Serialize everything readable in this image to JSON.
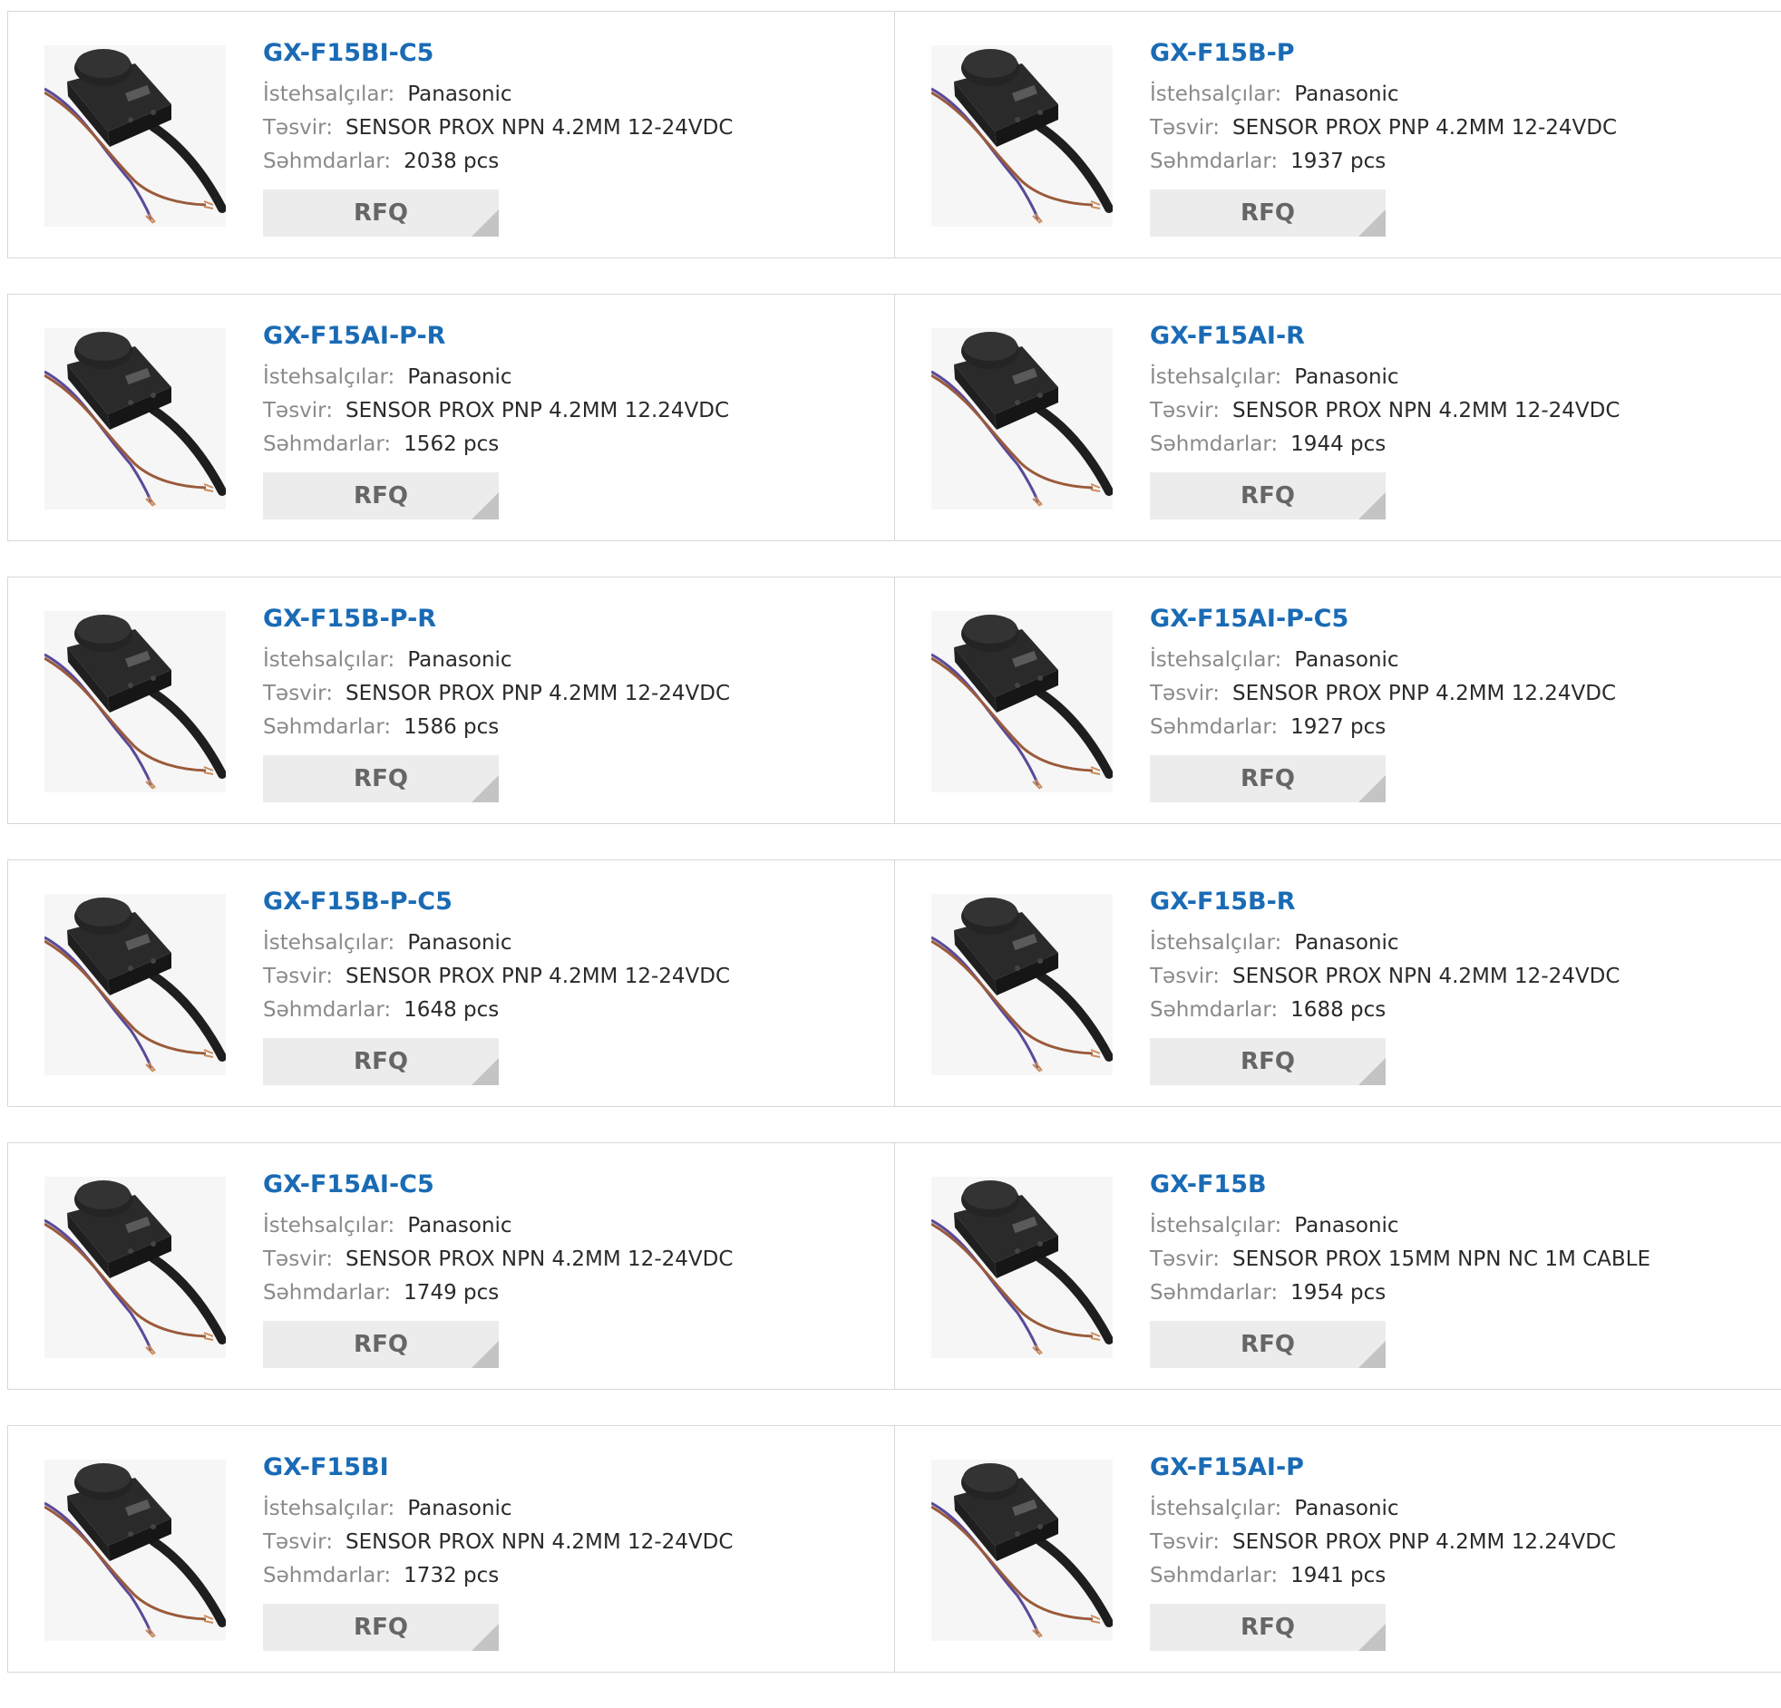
{
  "labels": {
    "manufacturer": "İstehsalçılar:",
    "description": "Təsvir:",
    "stock": "Səhmdarlar:",
    "rfq": "RFQ"
  },
  "rows": [
    [
      {
        "part": "GX-F15BI-C5",
        "manufacturer": "Panasonic",
        "description": "SENSOR PROX NPN 4.2MM 12-24VDC",
        "stock": "2038 pcs",
        "image_icon": "sensor-product-photo"
      },
      {
        "part": "GX-F15B-P",
        "manufacturer": "Panasonic",
        "description": "SENSOR PROX PNP 4.2MM 12-24VDC",
        "stock": "1937 pcs",
        "image_icon": "sensor-product-photo"
      }
    ],
    [
      {
        "part": "GX-F15AI-P-R",
        "manufacturer": "Panasonic",
        "description": "SENSOR PROX PNP 4.2MM 12.24VDC",
        "stock": "1562 pcs",
        "image_icon": "sensor-product-photo"
      },
      {
        "part": "GX-F15AI-R",
        "manufacturer": "Panasonic",
        "description": "SENSOR PROX NPN 4.2MM 12-24VDC",
        "stock": "1944 pcs",
        "image_icon": "sensor-product-photo"
      }
    ],
    [
      {
        "part": "GX-F15B-P-R",
        "manufacturer": "Panasonic",
        "description": "SENSOR PROX PNP 4.2MM 12-24VDC",
        "stock": "1586 pcs",
        "image_icon": "sensor-product-photo"
      },
      {
        "part": "GX-F15AI-P-C5",
        "manufacturer": "Panasonic",
        "description": "SENSOR PROX PNP 4.2MM 12.24VDC",
        "stock": "1927 pcs",
        "image_icon": "sensor-product-photo"
      }
    ],
    [
      {
        "part": "GX-F15B-P-C5",
        "manufacturer": "Panasonic",
        "description": "SENSOR PROX PNP 4.2MM 12-24VDC",
        "stock": "1648 pcs",
        "image_icon": "sensor-product-photo"
      },
      {
        "part": "GX-F15B-R",
        "manufacturer": "Panasonic",
        "description": "SENSOR PROX NPN 4.2MM 12-24VDC",
        "stock": "1688 pcs",
        "image_icon": "sensor-product-photo"
      }
    ],
    [
      {
        "part": "GX-F15AI-C5",
        "manufacturer": "Panasonic",
        "description": "SENSOR PROX NPN 4.2MM 12-24VDC",
        "stock": "1749 pcs",
        "image_icon": "sensor-product-photo"
      },
      {
        "part": "GX-F15B",
        "manufacturer": "Panasonic",
        "description": "SENSOR PROX 15MM NPN NC 1M CABLE",
        "stock": "1954 pcs",
        "image_icon": "sensor-product-photo"
      }
    ],
    [
      {
        "part": "GX-F15BI",
        "manufacturer": "Panasonic",
        "description": "SENSOR PROX NPN 4.2MM 12-24VDC",
        "stock": "1732 pcs",
        "image_icon": "sensor-product-photo"
      },
      {
        "part": "GX-F15AI-P",
        "manufacturer": "Panasonic",
        "description": "SENSOR PROX PNP 4.2MM 12.24VDC",
        "stock": "1941 pcs",
        "image_icon": "sensor-product-photo"
      }
    ]
  ],
  "colors": {
    "link": "#1a6bb5",
    "label": "#8a8a8a",
    "value": "#2a2a2a",
    "button_bg": "#ececec",
    "button_text": "#666666",
    "border": "#d7d7d7"
  }
}
